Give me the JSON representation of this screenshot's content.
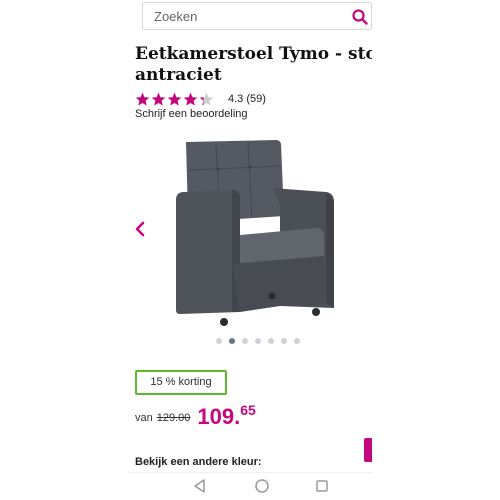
{
  "search": {
    "placeholder": "Zoeken",
    "icon": "search-icon"
  },
  "product": {
    "title_line1": "Eetkamerstoel Tymo - stof",
    "title_line2": "antraciet",
    "rating": {
      "stars": 4.3,
      "stars_max": 5,
      "score": "4.3",
      "count": "(59)"
    },
    "review_link": "Schrijf een beoordeling"
  },
  "gallery": {
    "image_count": 7,
    "active_index": 1,
    "prev_icon": "chevron-left-icon"
  },
  "discount": {
    "label": "15 % korting"
  },
  "price": {
    "van_label": "van",
    "old": "129.00",
    "new_int": "109.",
    "new_dec": "65"
  },
  "other_color": {
    "label": "Bekijk een andere kleur:"
  },
  "colors": {
    "accent": "#c4077f",
    "badge_border": "#5cb82e",
    "dot_active": "#6b7489",
    "dot_inactive": "#d0d0d8"
  },
  "android_nav": {
    "icons": [
      "back-triangle-icon",
      "home-circle-icon",
      "recents-square-icon"
    ]
  }
}
